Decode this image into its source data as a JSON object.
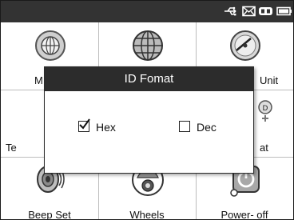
{
  "status_bar": {
    "icons": [
      "usb-icon",
      "mail-icon",
      "battery-linked-icon",
      "battery-icon"
    ]
  },
  "tiles": [
    {
      "label": "M",
      "icon": "globe-network-icon"
    },
    {
      "label": "",
      "icon": "globe-grid-icon"
    },
    {
      "label": "Unit",
      "icon": "gauge-icon"
    },
    {
      "label": "Te",
      "icon": ""
    },
    {
      "label": "",
      "icon": ""
    },
    {
      "label": "at",
      "icon": "id-format-icon"
    },
    {
      "label": "Beep Set",
      "icon": "speaker-icon"
    },
    {
      "label": "Wheels",
      "icon": "car-wheel-icon"
    },
    {
      "label": "Power- off",
      "icon": "power-icon"
    }
  ],
  "dialog": {
    "title": "ID Fomat",
    "options": [
      {
        "label": "Hex",
        "checked": true
      },
      {
        "label": "Dec",
        "checked": false
      }
    ]
  }
}
